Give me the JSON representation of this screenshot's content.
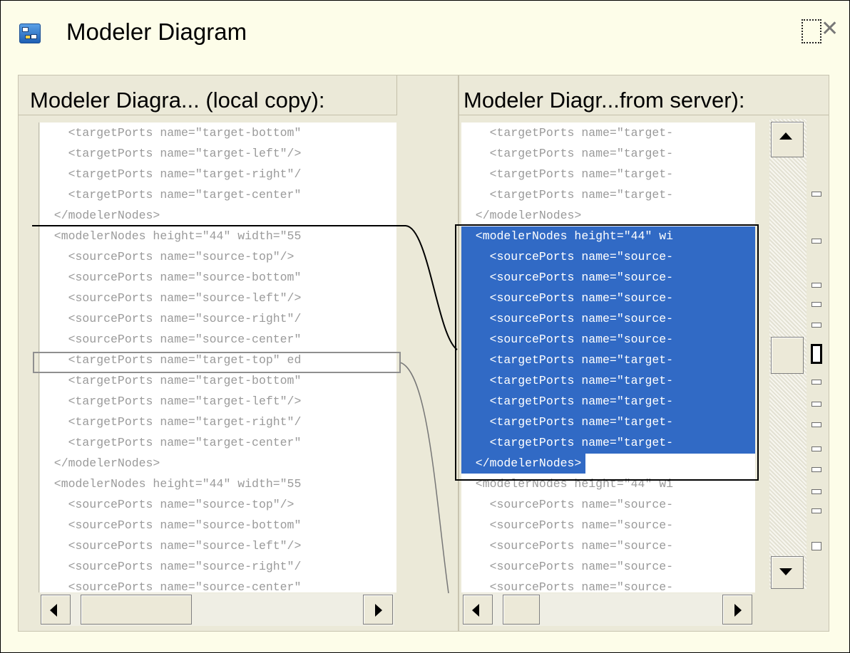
{
  "window": {
    "title": "Modeler Diagram"
  },
  "icons": {
    "app": "diagram-app-icon",
    "maximize": "maximize-icon",
    "close": "close-icon"
  },
  "left_panel": {
    "header": "Modeler Diagra... (local copy):",
    "lines": [
      "    <targetPorts name=\"target-bottom\"",
      "    <targetPorts name=\"target-left\"/>",
      "    <targetPorts name=\"target-right\"/",
      "    <targetPorts name=\"target-center\"",
      "  </modelerNodes>",
      "  <modelerNodes height=\"44\" width=\"55",
      "    <sourcePorts name=\"source-top\"/>",
      "    <sourcePorts name=\"source-bottom\"",
      "    <sourcePorts name=\"source-left\"/>",
      "    <sourcePorts name=\"source-right\"/",
      "    <sourcePorts name=\"source-center\"",
      "    <targetPorts name=\"target-top\" ed",
      "    <targetPorts name=\"target-bottom\"",
      "    <targetPorts name=\"target-left\"/>",
      "    <targetPorts name=\"target-right\"/",
      "    <targetPorts name=\"target-center\"",
      "  </modelerNodes>",
      "  <modelerNodes height=\"44\" width=\"55",
      "    <sourcePorts name=\"source-top\"/>",
      "    <sourcePorts name=\"source-bottom\"",
      "    <sourcePorts name=\"source-left\"/>",
      "    <sourcePorts name=\"source-right\"/",
      "    <sourcePorts name=\"source-center\""
    ]
  },
  "right_panel": {
    "header": "Modeler Diagr...from server):",
    "lines": [
      "    <targetPorts name=\"target-",
      "    <targetPorts name=\"target-",
      "    <targetPorts name=\"target-",
      "    <targetPorts name=\"target-",
      "  </modelerNodes>",
      "  <modelerNodes height=\"44\" wi",
      "    <sourcePorts name=\"source-",
      "    <sourcePorts name=\"source-",
      "    <sourcePorts name=\"source-",
      "    <sourcePorts name=\"source-",
      "    <sourcePorts name=\"source-",
      "    <targetPorts name=\"target-",
      "    <targetPorts name=\"target-",
      "    <targetPorts name=\"target-",
      "    <targetPorts name=\"target-",
      "    <targetPorts name=\"target-",
      "  </modelerNodes>",
      "  <modelerNodes height=\"44\" wi",
      "    <sourcePorts name=\"source-",
      "    <sourcePorts name=\"source-",
      "    <sourcePorts name=\"source-",
      "    <sourcePorts name=\"source-",
      "    <sourcePorts name=\"source-"
    ],
    "selected_range": {
      "first_line": 6,
      "last_line": 17
    }
  },
  "colors": {
    "selection": "#316ac5",
    "background": "#fdfde9",
    "code_text": "#9a9a9a"
  }
}
